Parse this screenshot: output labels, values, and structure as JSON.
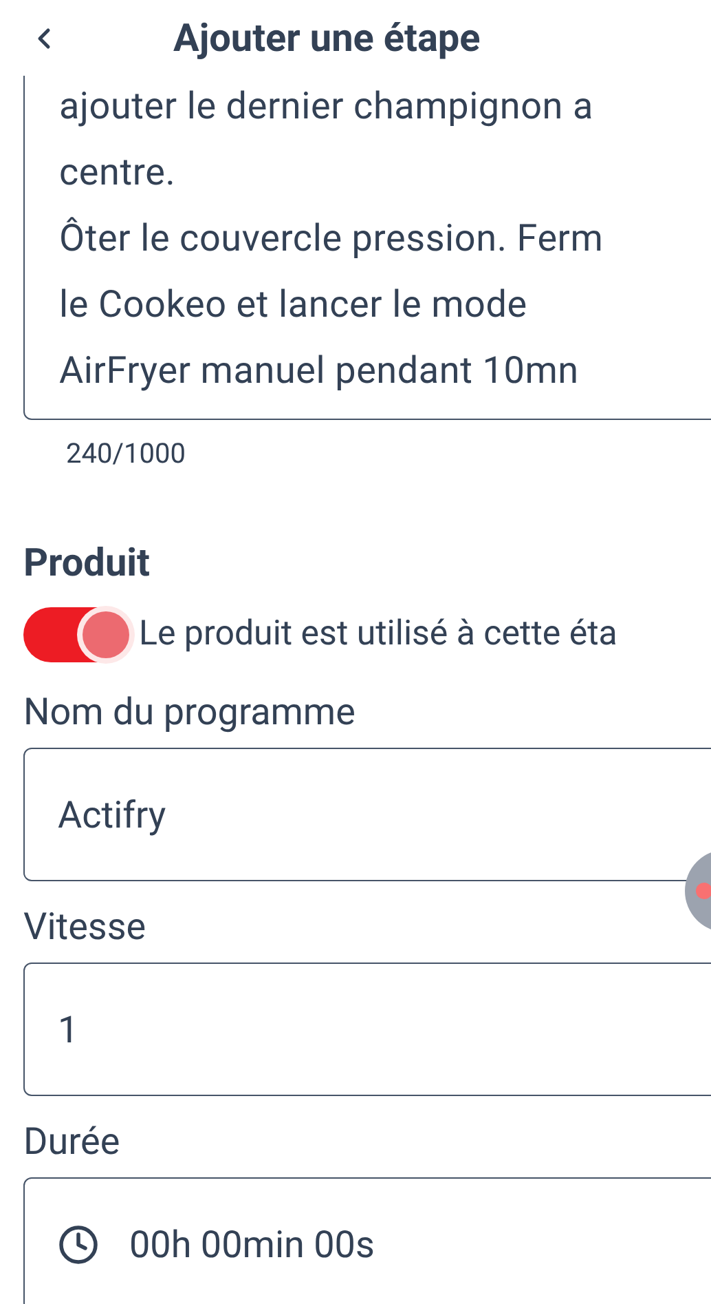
{
  "header": {
    "title": "Ajouter une étape"
  },
  "description": {
    "lines": [
      "ajouter le dernier champignon a",
      "centre.",
      "Ôter le couvercle pression. Ferm",
      "le Cookeo et lancer le mode",
      "AirFryer manuel pendant 10mn"
    ]
  },
  "counter": "240/1000",
  "section_title": "Produit",
  "product_toggle": {
    "on": true,
    "label": "Le produit est utilisé à cette éta"
  },
  "fields": [
    {
      "kind": "text",
      "label": "Nom du programme",
      "value": "Actifry"
    },
    {
      "kind": "text",
      "label": "Vitesse",
      "value": "1"
    },
    {
      "kind": "duration",
      "label": "Durée",
      "value": "00h 00min 00s"
    }
  ]
}
